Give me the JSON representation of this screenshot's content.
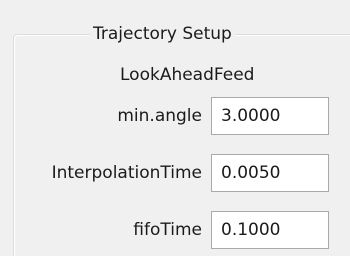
{
  "group": {
    "title": "Trajectory Setup",
    "feed_mode": "LookAheadFeed"
  },
  "params": [
    {
      "label": "min.angle",
      "value": "3.0000"
    },
    {
      "label": "InterpolationTime",
      "value": "0.0050"
    },
    {
      "label": "fifoTime",
      "value": "0.1000"
    }
  ]
}
